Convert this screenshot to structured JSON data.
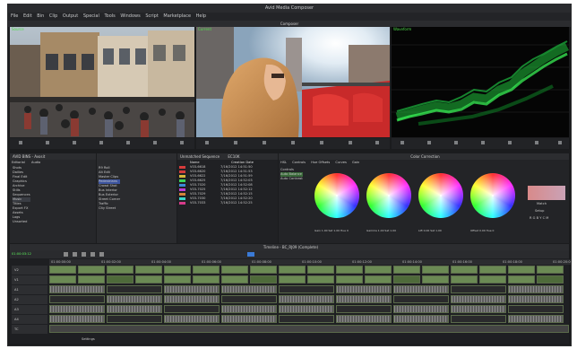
{
  "window": {
    "title": "Avid Media Composer"
  },
  "menu": [
    "File",
    "Edit",
    "Bin",
    "Clip",
    "Output",
    "Special",
    "Tools",
    "Windows",
    "Script",
    "Marketplace",
    "Help"
  ],
  "composer": {
    "title": "Composer",
    "source_label": "Source",
    "record_label": "Current",
    "scope_label": "Waveform"
  },
  "bin": {
    "title": "AVID BINS - Avosit",
    "tabs": [
      "Editorial",
      "Audio"
    ],
    "folders": [
      "Shots",
      "Dailies",
      "Final Edit",
      "Graphics",
      "Archive",
      "Stills",
      "Sequences",
      "Music",
      "Titles",
      "Export FX",
      "Assets",
      "Logs",
      "Unsorted"
    ],
    "clips": [
      "R9 Roll",
      "Alt Edit",
      "Master Clips",
      "Pedestrians",
      "Crowd Shot",
      "Bus Interior",
      "Bus Exterior",
      "Street Corner",
      "Traffic",
      "City Street"
    ]
  },
  "clipbin": {
    "tab1": "Unmatched Sequence",
    "tab2": "EC10K",
    "columns": [
      "Name",
      "Creation Date"
    ],
    "rows": [
      {
        "name": "V03-6618",
        "date": "7/16/2012 14:51:50",
        "color": "#d63b3b"
      },
      {
        "name": "V03-6620",
        "date": "7/16/2012 14:51:53",
        "color": "#d63b3b"
      },
      {
        "name": "V03-6622",
        "date": "7/16/2012 14:51:59",
        "color": "#d6b63b"
      },
      {
        "name": "V03-6625",
        "date": "7/16/2012 14:52:03",
        "color": "#3bd65a"
      },
      {
        "name": "V03-7020",
        "date": "7/16/2012 14:52:08",
        "color": "#3b8ad6"
      },
      {
        "name": "V03-7025",
        "date": "7/16/2012 14:52:12",
        "color": "#c03bd6"
      },
      {
        "name": "V03-7029",
        "date": "7/16/2012 14:52:15",
        "color": "#d6833b"
      },
      {
        "name": "V03-7030",
        "date": "7/16/2012 14:52:20",
        "color": "#3bd6c8"
      },
      {
        "name": "V03-7033",
        "date": "7/16/2012 14:52:25",
        "color": "#d63b8a"
      }
    ]
  },
  "color": {
    "title": "Color Correction",
    "tabs": [
      "HSL",
      "Controls",
      "Hue Offsets",
      "Curves",
      "Gain"
    ],
    "left_items": [
      "Controls",
      "Auto Balance",
      "Auto Contrast"
    ],
    "wheel_values": [
      "Gain 1.00  Sat 1.00  Hue 0",
      "Gamma 1.00  Sat 1.00",
      "Lift 0.00  Sat 1.00",
      "Offset 0.00  Hue 0"
    ],
    "side": {
      "match": "Match",
      "setup": "Setup",
      "buttons": [
        "R",
        "G",
        "B",
        "Y",
        "C",
        "M"
      ]
    }
  },
  "timeline": {
    "title": "Timeline - BC_RJ09 (Complete)",
    "timecode": "01:00:03:12",
    "ruler": [
      "01:00:00:00",
      "01:00:02:00",
      "01:00:04:00",
      "01:00:06:00",
      "01:00:08:00",
      "01:00:10:00",
      "01:00:12:00",
      "01:00:14:00",
      "01:00:16:00",
      "01:00:18:00",
      "01:00:20:00"
    ],
    "tracks": [
      "V2",
      "V1",
      "A1",
      "A2",
      "A3",
      "A4",
      "TC"
    ],
    "bottom_label": "Settings"
  }
}
